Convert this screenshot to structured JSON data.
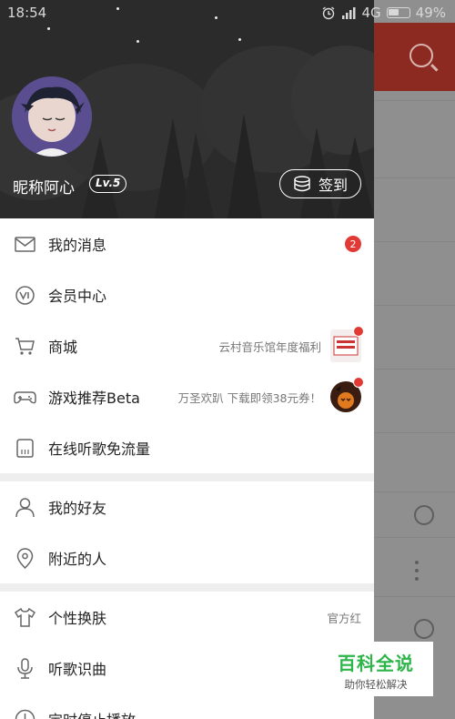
{
  "status_bar": {
    "time": "18:54",
    "network": "4G",
    "battery": "49%"
  },
  "drawer": {
    "username": "昵称阿心",
    "level": "Lv.5",
    "signin_label": "签到"
  },
  "menu": {
    "messages": {
      "label": "我的消息",
      "badge": "2"
    },
    "membership": {
      "label": "会员中心"
    },
    "store": {
      "label": "商城",
      "promo": "云村音乐馆年度福利"
    },
    "games": {
      "label": "游戏推荐Beta",
      "promo": "万圣欢趴 下载即领38元券！"
    },
    "free_data": {
      "label": "在线听歌免流量"
    },
    "friends": {
      "label": "我的好友"
    },
    "nearby": {
      "label": "附近的人"
    },
    "themes": {
      "label": "个性换肤",
      "value": "官方红"
    },
    "recognize": {
      "label": "听歌识曲"
    },
    "timer": {
      "label": "定时停止播放"
    }
  },
  "watermark": {
    "title": "百科全说",
    "subtitle": "助你轻松解决"
  },
  "colors": {
    "accent": "#e13a35",
    "header_bg": "#2b2b2b",
    "watermark_green": "#2db54a"
  }
}
